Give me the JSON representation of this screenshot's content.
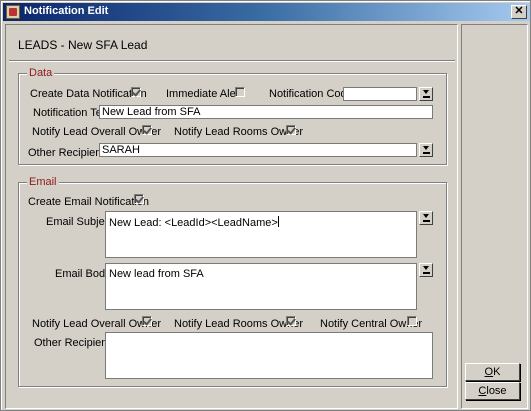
{
  "window": {
    "title": "Notification Edit",
    "header_label": "LEADS - New SFA Lead"
  },
  "data_group": {
    "legend": "Data",
    "create_data_notification": {
      "label": "Create Data Notification",
      "checked": true
    },
    "immediate_alert": {
      "label": "Immediate Alert",
      "checked": false
    },
    "notification_code": {
      "label": "Notification Code",
      "value": ""
    },
    "notification_text": {
      "label": "Notification Text",
      "value": "New Lead from SFA"
    },
    "notify_lead_overall_owner": {
      "label": "Notify Lead Overall Owner",
      "checked": true
    },
    "notify_lead_rooms_owner": {
      "label": "Notify Lead Rooms Owner",
      "checked": true
    },
    "other_recipients": {
      "label": "Other Recipients",
      "value": "SARAH"
    }
  },
  "email_group": {
    "legend": "Email",
    "create_email_notification": {
      "label": "Create Email Notification",
      "checked": true
    },
    "email_subject": {
      "label": "Email Subject",
      "value": "New Lead: <LeadId><LeadName>"
    },
    "email_body": {
      "label": "Email Body",
      "value": "New lead from SFA"
    },
    "notify_lead_overall_owner": {
      "label": "Notify Lead Overall Owner",
      "checked": true
    },
    "notify_lead_rooms_owner": {
      "label": "Notify Lead Rooms Owner",
      "checked": true
    },
    "notify_central_owner": {
      "label": "Notify Central Owner",
      "checked": false
    },
    "other_recipients": {
      "label": "Other Recipients",
      "value": ""
    }
  },
  "buttons": {
    "ok": {
      "accel": "O",
      "rest": "K"
    },
    "close": {
      "accel": "C",
      "rest": "lose"
    }
  },
  "icons": {
    "title_icon": "app-icon",
    "close": "close-icon",
    "dropdown": "dropdown-icon"
  }
}
